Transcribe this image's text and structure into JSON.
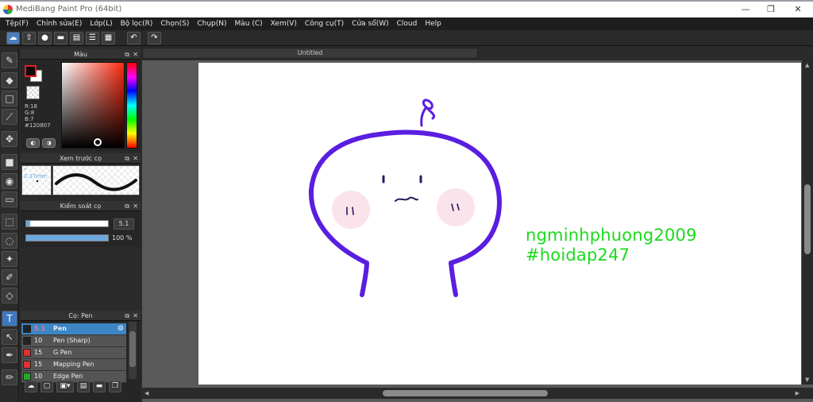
{
  "window": {
    "title": "MediBang Paint Pro (64bit)",
    "minimize": "—",
    "maximize": "❐",
    "close": "✕"
  },
  "menu": [
    "Tệp(F)",
    "Chỉnh sửa(E)",
    "Lớp(L)",
    "Bộ lọc(R)",
    "Chọn(S)",
    "Chụp(N)",
    "Màu (C)",
    "Xem(V)",
    "Công cụ(T)",
    "Cửa sổ(W)",
    "Cloud",
    "Help"
  ],
  "color_panel": {
    "title": "Màu",
    "r": "R:18",
    "g": "G:8",
    "b": "B:7",
    "hex": "#120807",
    "foreground": "#120807",
    "hue_base": "#ff2a10"
  },
  "brush_preview": {
    "title": "Xem trước cọ",
    "size": "0.37mm"
  },
  "brush_control": {
    "title": "Kiểm soát cọ",
    "size_value": "5.1",
    "size_fraction": 0.05,
    "opacity_label": "100 %",
    "opacity_fraction": 1.0
  },
  "brush_list": {
    "title": "Cọ: Pen",
    "items": [
      {
        "size": "5.1",
        "name": "Pen",
        "color": "#222222",
        "selected": true
      },
      {
        "size": "10",
        "name": "Pen (Sharp)",
        "color": "#222222",
        "selected": false
      },
      {
        "size": "15",
        "name": "G Pen",
        "color": "#e03030",
        "selected": false
      },
      {
        "size": "15",
        "name": "Mapping Pen",
        "color": "#e03030",
        "selected": false
      },
      {
        "size": "10",
        "name": "Edge Pen",
        "color": "#22aa22",
        "selected": false
      }
    ]
  },
  "document": {
    "tab_title": "Untitled"
  },
  "canvas_text": {
    "line1": "ngminhphuong2009",
    "line2": "#hoidap247",
    "color": "#1adb1a"
  },
  "drawing_colors": {
    "outline": "#5a1ee0",
    "blush": "#fbe3ec",
    "face": "#2a1a60"
  }
}
